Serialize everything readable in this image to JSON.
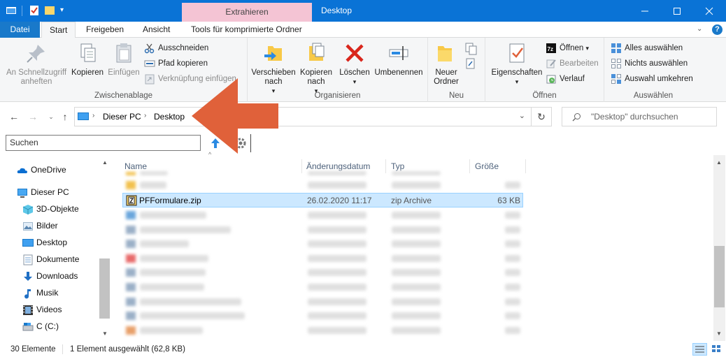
{
  "window": {
    "title": "Desktop",
    "context_tab": "Extrahieren"
  },
  "tabs": {
    "datei": "Datei",
    "start": "Start",
    "freigeben": "Freigeben",
    "ansicht": "Ansicht",
    "tools": "Tools für komprimierte Ordner"
  },
  "ribbon": {
    "clipboard": {
      "pin": "An Schnellzugriff anheften",
      "copy": "Kopieren",
      "paste": "Einfügen",
      "cut": "Ausschneiden",
      "copy_path": "Pfad kopieren",
      "paste_shortcut": "Verknüpfung einfügen",
      "label": "Zwischenablage"
    },
    "organize": {
      "move_to": "Verschieben nach",
      "copy_to": "Kopieren nach",
      "delete": "Löschen",
      "rename": "Umbenennen",
      "label": "Organisieren"
    },
    "new": {
      "new_folder": "Neuer Ordner",
      "label": "Neu"
    },
    "open": {
      "properties": "Eigenschaften",
      "open": "Öffnen",
      "edit": "Bearbeiten",
      "history": "Verlauf",
      "label": "Öffnen"
    },
    "select": {
      "select_all": "Alles auswählen",
      "select_none": "Nichts auswählen",
      "invert": "Auswahl umkehren",
      "label": "Auswählen"
    }
  },
  "address": {
    "crumb1": "Dieser PC",
    "crumb2": "Desktop",
    "search_placeholder": "\"Desktop\" durchsuchen"
  },
  "left_search": {
    "value": "Suchen"
  },
  "nav": {
    "onedrive": "OneDrive",
    "thispc": "Dieser PC",
    "objects3d": "3D-Objekte",
    "pictures": "Bilder",
    "desktop": "Desktop",
    "documents": "Dokumente",
    "downloads": "Downloads",
    "music": "Musik",
    "videos": "Videos",
    "drive_c": "C (C:)"
  },
  "columns": {
    "name": "Name",
    "date": "Änderungsdatum",
    "type": "Typ",
    "size": "Größe"
  },
  "selected_file": {
    "name": "PFFormulare.zip",
    "date": "26.02.2020 11:17",
    "type": "zip Archive",
    "size": "63 KB"
  },
  "status": {
    "count": "30 Elemente",
    "selection": "1 Element ausgewählt (62,8 KB)"
  },
  "colors": {
    "titlebar": "#0a73d6",
    "context_tab": "#f4c4d4",
    "selection": "#cce8ff",
    "arrow": "#e0613a"
  }
}
